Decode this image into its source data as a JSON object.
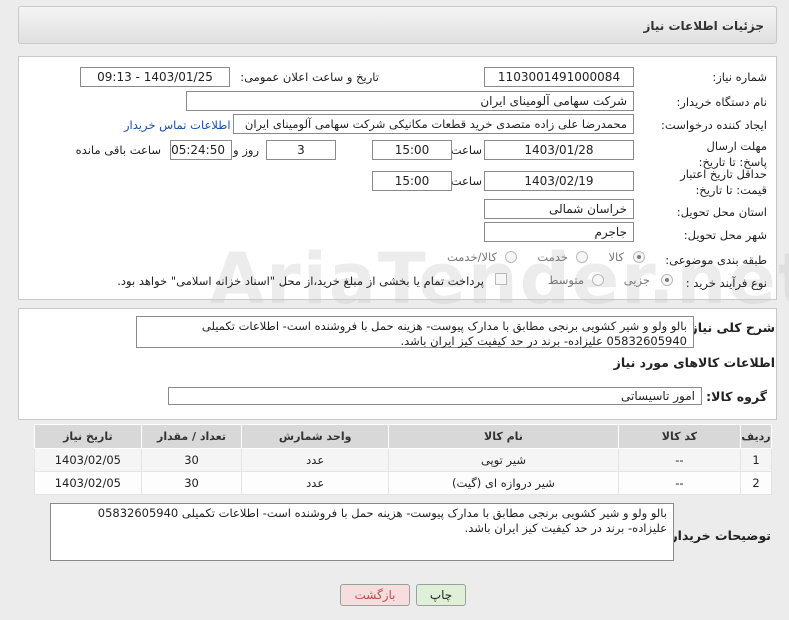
{
  "header": {
    "title": "جزئیات اطلاعات نیاز"
  },
  "form": {
    "need_number_label": "شماره نیاز:",
    "need_number": "1103001491000084",
    "announce_label": "تاریخ و ساعت اعلان عمومی:",
    "announce_value": "1403/01/25 - 09:13",
    "buyer_org_label": "نام دستگاه خریدار:",
    "buyer_org": "شرکت سهامی آلومینای ایران",
    "creator_label": "ایجاد کننده درخواست:",
    "creator": "محمدرضا علی زاده متصدی خرید قطعات مکانیکی شرکت سهامی آلومینای ایران",
    "contact_link": "اطلاعات تماس خریدار",
    "deadline_label": "مهلت ارسال پاسخ: تا تاریخ:",
    "deadline_date": "1403/01/28",
    "time_label": "ساعت",
    "deadline_time": "15:00",
    "days_value": "3",
    "days_label": "روز و",
    "remaining_time": "05:24:50",
    "remaining_label": "ساعت باقی مانده",
    "validity_label": "حداقل تاریخ اعتبار قیمت: تا تاریخ:",
    "validity_date": "1403/02/19",
    "validity_time_label": "ساعت",
    "validity_time": "15:00",
    "province_label": "استان محل تحویل:",
    "province": "خراسان شمالی",
    "city_label": "شهر محل تحویل:",
    "city": "جاجرم",
    "category_label": "طبقه بندی موضوعی:",
    "category_options": [
      "کالا",
      "خدمت",
      "کالا/خدمت"
    ],
    "process_label": "نوع فرآیند خرید :",
    "process_options": [
      "جزیی",
      "متوسط"
    ],
    "treasury_note": "پرداخت تمام یا بخشی از مبلغ خرید،از محل \"اسناد خزانه اسلامی\" خواهد بود."
  },
  "description": {
    "label": "شرح کلی نیاز:",
    "text": "بالو ولو و شیر کشویی برنجی مطابق با مدارک پیوست- هزینه حمل با فروشنده است- اطلاعات تکمیلی 05832605940 علیزاده- برند در حد کیفیت کیز ایران باشد."
  },
  "goods_section": {
    "title": "اطلاعات کالاهای مورد نیاز",
    "group_label": "گروه کالا:",
    "group_value": "امور تاسیساتی",
    "columns": [
      "ردیف",
      "کد کالا",
      "نام کالا",
      "واحد شمارش",
      "تعداد / مقدار",
      "تاریخ نیاز"
    ],
    "rows": [
      {
        "idx": "1",
        "code": "--",
        "name": "شیر توپی",
        "unit": "عدد",
        "qty": "30",
        "date": "1403/02/05"
      },
      {
        "idx": "2",
        "code": "--",
        "name": "شیر دروازه ای (گیت)",
        "unit": "عدد",
        "qty": "30",
        "date": "1403/02/05"
      }
    ]
  },
  "buyer_notes": {
    "label": "توضیحات خریدار:",
    "text": "بالو ولو و شیر کشویی برنجی مطابق با مدارک پیوست- هزینه حمل با فروشنده است- اطلاعات تکمیلی 05832605940 علیزاده- برند در حد کیفیت کیز ایران باشد."
  },
  "buttons": {
    "print": "چاپ",
    "back": "بازگشت"
  },
  "watermark": "AriaTender.net",
  "colors": {
    "link": "#1a4fa6",
    "print_bg": "#dff0d8",
    "back_bg": "#f7dede"
  }
}
